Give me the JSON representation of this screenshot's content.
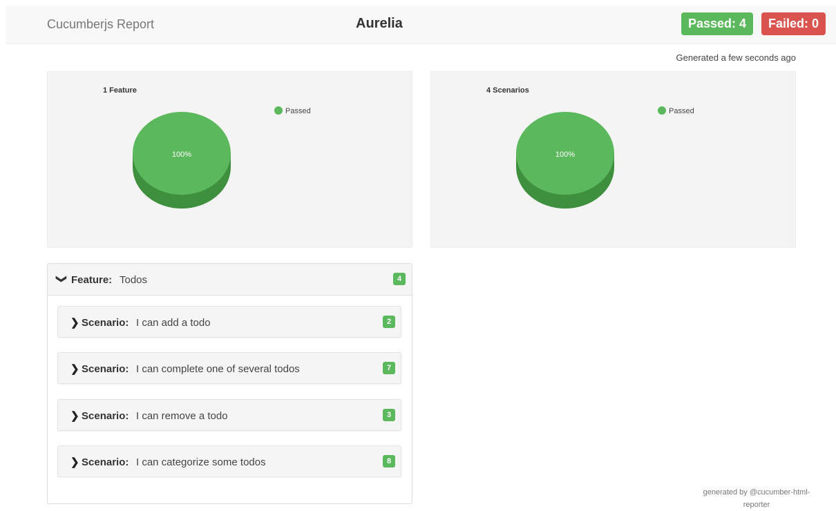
{
  "header": {
    "brand": "Cucumberjs Report",
    "title": "Aurelia",
    "passed_label": "Passed: 4",
    "failed_label": "Failed: 0"
  },
  "generated_text": "Generated a few seconds ago",
  "chart_data": [
    {
      "type": "pie",
      "title": "1 Feature",
      "legend": [
        "Passed"
      ],
      "legend_position": "top-right",
      "slices": [
        {
          "label": "Passed",
          "value": 100,
          "color": "#5cb85c"
        }
      ],
      "data_label": "100%"
    },
    {
      "type": "pie",
      "title": "4 Scenarios",
      "legend": [
        "Passed"
      ],
      "legend_position": "top-right",
      "slices": [
        {
          "label": "Passed",
          "value": 100,
          "color": "#5cb85c"
        }
      ],
      "data_label": "100%"
    }
  ],
  "feature": {
    "keyword": "Feature:",
    "name": "Todos",
    "count": "4",
    "scenarios": [
      {
        "keyword": "Scenario:",
        "name": "I can add a todo",
        "count": "2"
      },
      {
        "keyword": "Scenario:",
        "name": "I can complete one of several todos",
        "count": "7"
      },
      {
        "keyword": "Scenario:",
        "name": "I can remove a todo",
        "count": "3"
      },
      {
        "keyword": "Scenario:",
        "name": "I can categorize some todos",
        "count": "8"
      }
    ]
  },
  "footer": {
    "line1": "generated by @cucumber-html-",
    "line2": "reporter"
  },
  "colors": {
    "passed": "#5cb85c",
    "passed_dark": "#3e8f3e",
    "failed": "#d9534f"
  }
}
